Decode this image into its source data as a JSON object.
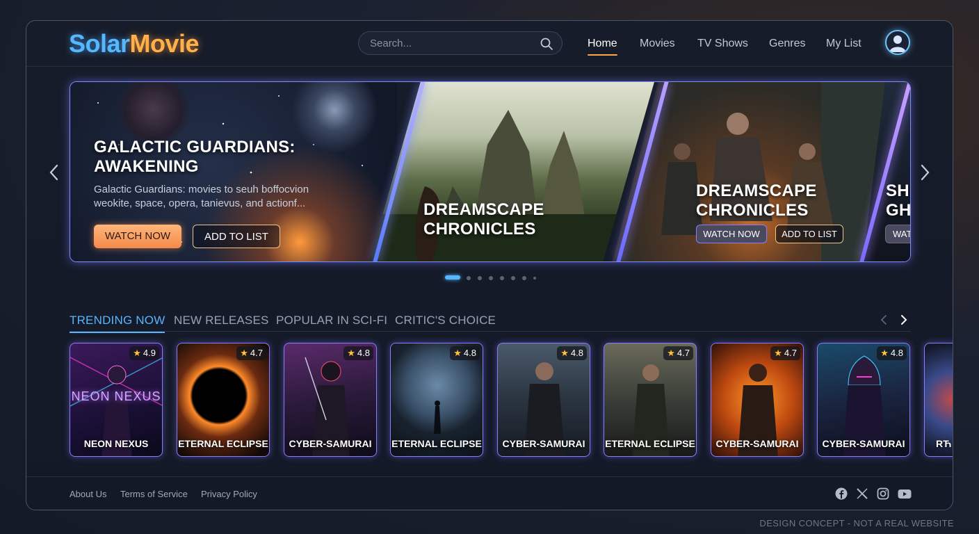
{
  "app": {
    "logo_part1": "Solar",
    "logo_part2": "Movie"
  },
  "search": {
    "placeholder": "Search..."
  },
  "nav": [
    {
      "label": "Home",
      "active": true
    },
    {
      "label": "Movies",
      "active": false
    },
    {
      "label": "TV Shows",
      "active": false
    },
    {
      "label": "Genres",
      "active": false
    },
    {
      "label": "My List",
      "active": false
    }
  ],
  "hero": {
    "slides": [
      {
        "title": "GALACTIC GUARDIANS:\nAWAKENING",
        "description": "Galactic Guardians: movies to seuh boffocvion weokite, space, opera, tanievus, and actionf...",
        "watch_label": "WATCH NOW",
        "add_label": "ADD TO LIST"
      },
      {
        "title": "DREAMSCAPE\nCHRONICLES"
      },
      {
        "title": "DREAMSCAPE\nCHRONICLES",
        "watch_label": "WATCH NOW",
        "add_label": "ADD TO LIST"
      },
      {
        "title": "SH\nGH",
        "watch_label": "WAT"
      }
    ],
    "active_dot": 0,
    "dot_count": 9
  },
  "tabs": [
    {
      "label": "TRENDING NOW",
      "active": true
    },
    {
      "label": "NEW RELEASES",
      "active": false
    },
    {
      "label": "POPULAR IN SCI-FI",
      "active": false
    },
    {
      "label": "CRITIC'S CHOICE",
      "active": false
    }
  ],
  "cards": [
    {
      "title": "NEON NEXUS",
      "rating": "4.9",
      "overlay_text": "NEON NEXUS",
      "theme": "neon"
    },
    {
      "title": "ETERNAL ECLIPSE",
      "rating": "4.7",
      "theme": "eclipse"
    },
    {
      "title": "CYBER-SAMURAI",
      "rating": "4.8",
      "theme": "samurai"
    },
    {
      "title": "ETERNAL ECLIPSE",
      "rating": "4.8",
      "theme": "moon"
    },
    {
      "title": "CYBER-SAMURAI",
      "rating": "4.8",
      "theme": "city"
    },
    {
      "title": "ETERNAL ECLIPSE",
      "rating": "4.7",
      "theme": "ruins"
    },
    {
      "title": "CYBER-SAMURAI",
      "rating": "4.7",
      "theme": "fire"
    },
    {
      "title": "CYBER-SAMURAI",
      "rating": "4.8",
      "theme": "hood"
    },
    {
      "title": "RЋ",
      "rating": "",
      "theme": "partial"
    }
  ],
  "footer": {
    "links": [
      "About Us",
      "Terms of Service",
      "Privacy Policy"
    ],
    "social": [
      "facebook-icon",
      "x-icon",
      "instagram-icon",
      "youtube-icon"
    ]
  },
  "disclaimer": "DESIGN CONCEPT - NOT A REAL WEBSITE",
  "colors": {
    "accent_blue": "#58b6ff",
    "accent_orange": "#ffa74a",
    "card_border": "#8a7cff",
    "star": "#ffc23a"
  }
}
